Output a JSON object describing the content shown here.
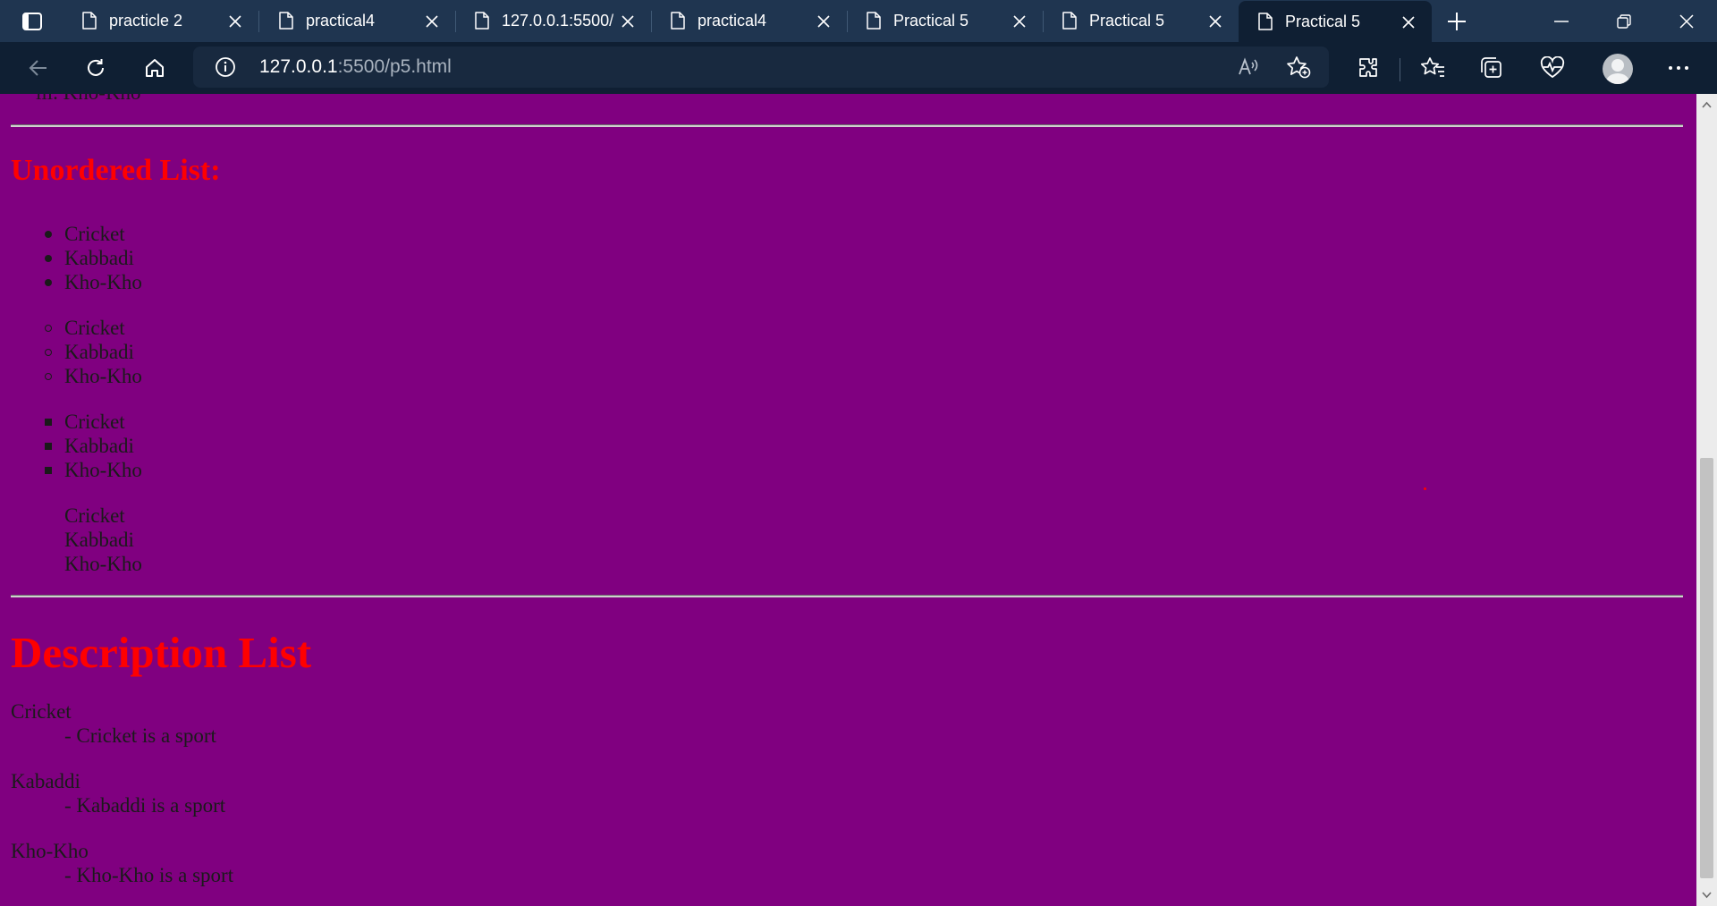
{
  "browser": {
    "tabs": [
      {
        "title": "practicle 2",
        "active": false
      },
      {
        "title": "practical4",
        "active": false
      },
      {
        "title": "127.0.0.1:5500/",
        "active": false
      },
      {
        "title": "practical4",
        "active": false
      },
      {
        "title": "Practical 5",
        "active": false
      },
      {
        "title": "Practical 5",
        "active": false
      },
      {
        "title": "Practical 5",
        "active": true
      }
    ],
    "address": {
      "host": "127.0.0.1",
      "path": ":5500/p5.html"
    },
    "icons": {
      "tab_actions": "tab-actions-icon",
      "tab": "page-icon",
      "close": "close-icon",
      "new_tab": "plus-icon",
      "back": "back-arrow-icon",
      "refresh": "refresh-icon",
      "home": "home-icon",
      "site_info": "info-icon",
      "read_aloud": "read-aloud-icon",
      "favorite": "add-favorite-icon",
      "extensions": "extensions-icon",
      "favorites": "favorites-icon",
      "collections": "collections-icon",
      "health": "browser-essentials-icon",
      "profile": "profile-avatar-icon",
      "menu": "more-icon"
    }
  },
  "page": {
    "clipped_item": "iii. Kho-Kho",
    "unordered_heading": "Unordered List:",
    "unordered_lists": [
      {
        "marker": "disc",
        "items": [
          "Cricket",
          "Kabbadi",
          "Kho-Kho"
        ]
      },
      {
        "marker": "circle",
        "items": [
          "Cricket",
          "Kabbadi",
          "Kho-Kho"
        ]
      },
      {
        "marker": "square",
        "items": [
          "Cricket",
          "Kabbadi",
          "Kho-Kho"
        ]
      },
      {
        "marker": "none",
        "items": [
          "Cricket",
          "Kabbadi",
          "Kho-Kho"
        ]
      }
    ],
    "description_heading": "Description List",
    "description_list": [
      {
        "term": "Cricket",
        "definition": "- Cricket is a sport"
      },
      {
        "term": "Kabaddi",
        "definition": "- Kabaddi is a sport"
      },
      {
        "term": "Kho-Kho",
        "definition": "- Kho-Kho is a sport"
      }
    ]
  },
  "colors": {
    "page_background": "#800080",
    "heading": "#ff0000",
    "tab_strip": "#1f3550",
    "toolbar": "#0f1f33"
  },
  "scroll": {
    "position_fraction": 1.0
  }
}
